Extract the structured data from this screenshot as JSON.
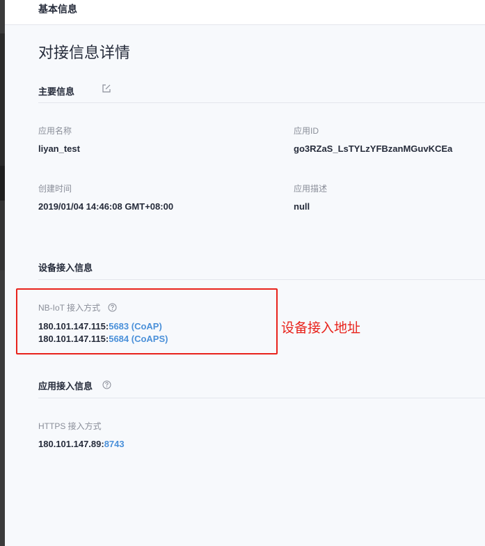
{
  "colors": {
    "accent": "#4a90d9",
    "annotation_red": "#e8221b",
    "text_primary": "#252b3a",
    "text_secondary": "#8a8e99"
  },
  "topbar": {
    "tab_label": "基本信息"
  },
  "page": {
    "title": "对接信息详情"
  },
  "main_info": {
    "title": "主要信息",
    "edit_icon": "edit-icon",
    "fields": {
      "app_name": {
        "label": "应用名称",
        "value": "liyan_test"
      },
      "app_id": {
        "label": "应用ID",
        "value": "go3RZaS_LsTYLzYFBzanMGuvKCEa"
      },
      "created_time": {
        "label": "创建时间",
        "value": "2019/01/04 14:46:08 GMT+08:00"
      },
      "app_desc": {
        "label": "应用描述",
        "value": "null"
      }
    }
  },
  "device_access": {
    "title": "设备接入信息",
    "nb_iot": {
      "label": "NB-IoT 接入方式",
      "help_icon": "help-icon",
      "addresses": [
        {
          "host": "180.101.147.115:",
          "port": "5683 (CoAP)"
        },
        {
          "host": "180.101.147.115:",
          "port": "5684 (CoAPS)"
        }
      ]
    },
    "annotation": "设备接入地址"
  },
  "app_access": {
    "title": "应用接入信息",
    "help_icon": "help-icon",
    "https": {
      "label": "HTTPS 接入方式",
      "host": "180.101.147.89:",
      "port": "8743"
    }
  }
}
